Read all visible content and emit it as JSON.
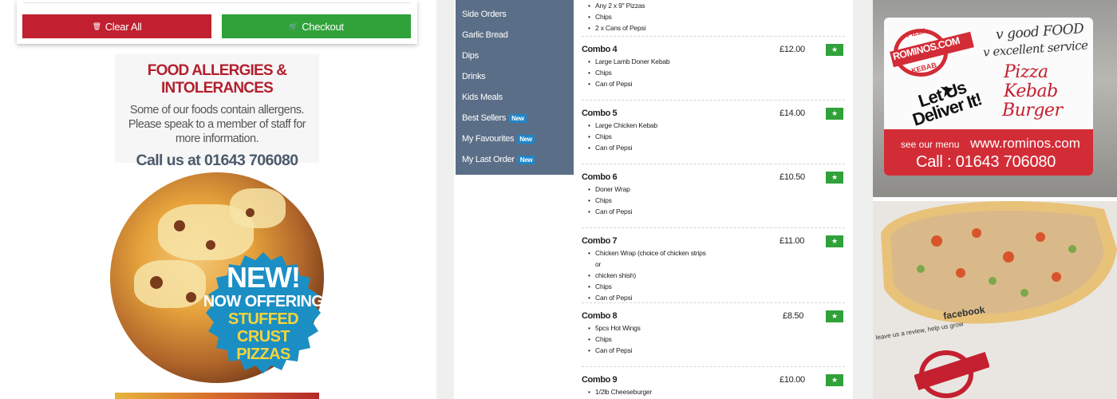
{
  "cart": {
    "clear_label": "Clear All",
    "checkout_label": "Checkout"
  },
  "allergy": {
    "heading": "FOOD ALLERGIES & INTOLERANCES",
    "line1": "Some of our foods contain allergens.",
    "line2": "Please speak to a member of staff for",
    "line3": "more information.",
    "phone": "Call us at 01643 706080"
  },
  "promo": {
    "line1": "NEW!",
    "line2": "NOW OFFERING",
    "line3": "STUFFED CRUST",
    "line4": "PIZZAS"
  },
  "sidebar": {
    "items": [
      {
        "label": "Side Orders",
        "tag": ""
      },
      {
        "label": "Garlic Bread",
        "tag": ""
      },
      {
        "label": "Dips",
        "tag": ""
      },
      {
        "label": "Drinks",
        "tag": ""
      },
      {
        "label": "Kids Meals",
        "tag": ""
      },
      {
        "label": "Best Sellers",
        "tag": "New"
      },
      {
        "label": "My Favourites",
        "tag": "New"
      },
      {
        "label": "My Last Order",
        "tag": "New"
      }
    ]
  },
  "menu": {
    "partial_top": [
      "Any 2 x 9\" Pizzas",
      "Chips",
      "2 x Cans of Pepsi"
    ],
    "combos": [
      {
        "name": "Combo 4",
        "price": "£12.00",
        "items": [
          "Large Lamb Doner Kebab",
          "Chips",
          "Can of Pepsi"
        ]
      },
      {
        "name": "Combo 5",
        "price": "£14.00",
        "items": [
          "Large Chicken Kebab",
          "Chips",
          "Can of Pepsi"
        ]
      },
      {
        "name": "Combo 6",
        "price": "£10.50",
        "items": [
          "Doner Wrap",
          "Chips",
          "Can of Pepsi"
        ]
      },
      {
        "name": "Combo 7",
        "price": "£11.00",
        "items": [
          "Chicken Wrap (choice of chicken strips or",
          "chicken shish)",
          "Chips",
          "Can of Pepsi"
        ]
      },
      {
        "name": "Combo 8",
        "price": "£8.50",
        "items": [
          "5pcs Hot Wings",
          "Chips",
          "Can of Pepsi"
        ]
      },
      {
        "name": "Combo 9",
        "price": "£10.00",
        "items": [
          "1/2lb Cheeseburger"
        ]
      }
    ]
  },
  "photo_card": {
    "logo_top": "PIZZA",
    "logo_main": "ROMINOS.COM",
    "logo_bottom": "KEBAB",
    "hand1": "v good FOOD",
    "hand2": "v excellent service",
    "hand3": "Pizza",
    "hand4": "Kebab",
    "hand5": "Burger",
    "deliver": "Let Us Deliver It!",
    "see_menu": "see our menu",
    "website": "www.rominos.com",
    "call": "Call : 01643 706080"
  },
  "photo_paper": {
    "review": "leave us a review, help us grow",
    "facebook": "facebook"
  },
  "colors": {
    "clear": "#c0202f",
    "checkout": "#31a13a",
    "sidebar": "#5b6e87",
    "new_tag": "#1f86c7",
    "badge": "#1b8fc4"
  }
}
